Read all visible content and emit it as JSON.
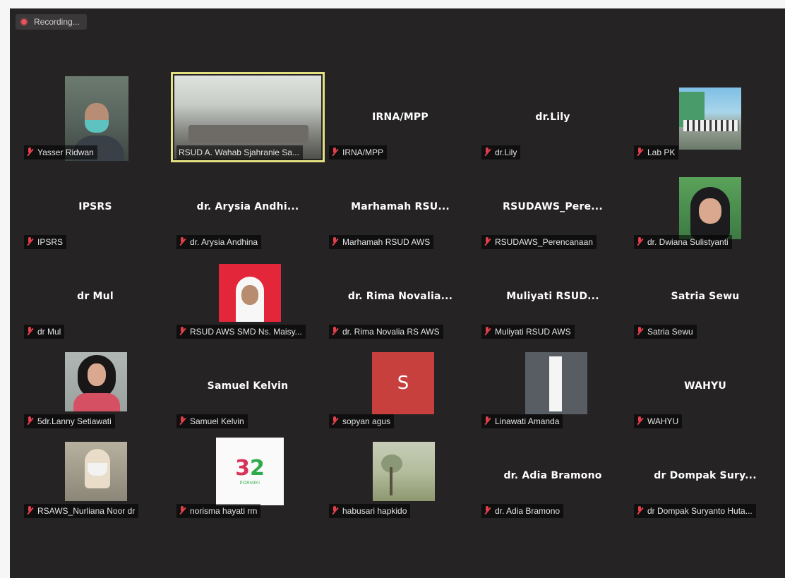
{
  "recording": {
    "text": "Recording..."
  },
  "participants": [
    {
      "label": "Yasser Ridwan",
      "display": ""
    },
    {
      "label": "RSUD A. Wahab Sjahranie Sa...",
      "display": ""
    },
    {
      "label": "IRNA/MPP",
      "display": "IRNA/MPP"
    },
    {
      "label": "dr.Lily",
      "display": "dr.Lily"
    },
    {
      "label": "Lab PK",
      "display": ""
    },
    {
      "label": "IPSRS",
      "display": "IPSRS"
    },
    {
      "label": "dr. Arysia Andhina",
      "display": "dr. Arysia Andhi..."
    },
    {
      "label": "Marhamah RSUD AWS",
      "display": "Marhamah  RSU..."
    },
    {
      "label": "RSUDAWS_Perencanaan",
      "display": "RSUDAWS_Pere..."
    },
    {
      "label": "dr. Dwiana Sulistyanti",
      "display": ""
    },
    {
      "label": "dr Mul",
      "display": "dr Mul"
    },
    {
      "label": "RSUD AWS SMD Ns. Maisy...",
      "display": ""
    },
    {
      "label": "dr. Rima Novalia RS AWS",
      "display": "dr. Rima Novalia..."
    },
    {
      "label": "Muliyati RSUD AWS",
      "display": "Muliyati  RSUD..."
    },
    {
      "label": "Satria Sewu",
      "display": "Satria Sewu"
    },
    {
      "label": "5dr.Lanny Setiawati",
      "display": ""
    },
    {
      "label": "Samuel Kelvin",
      "display": "Samuel Kelvin"
    },
    {
      "label": "sopyan agus",
      "display": "",
      "avatar_letter": "S"
    },
    {
      "label": "Linawati Amanda",
      "display": ""
    },
    {
      "label": "WAHYU",
      "display": "WAHYU"
    },
    {
      "label": "RSAWS_Nurliana Noor dr",
      "display": ""
    },
    {
      "label": "norisma hayati rm",
      "display": "",
      "logo_num": "3",
      "logo_num2": "2",
      "logo_sub": "PORMIKI"
    },
    {
      "label": "habusari hapkido",
      "display": ""
    },
    {
      "label": "dr. Adia Bramono",
      "display": "dr. Adia Bramono"
    },
    {
      "label": "dr Dompak Suryanto Huta...",
      "display": "dr Dompak Sury..."
    }
  ],
  "colors": {
    "background": "#252324",
    "active_border": "#e3e082",
    "muted_mic": "#e23f4a"
  }
}
